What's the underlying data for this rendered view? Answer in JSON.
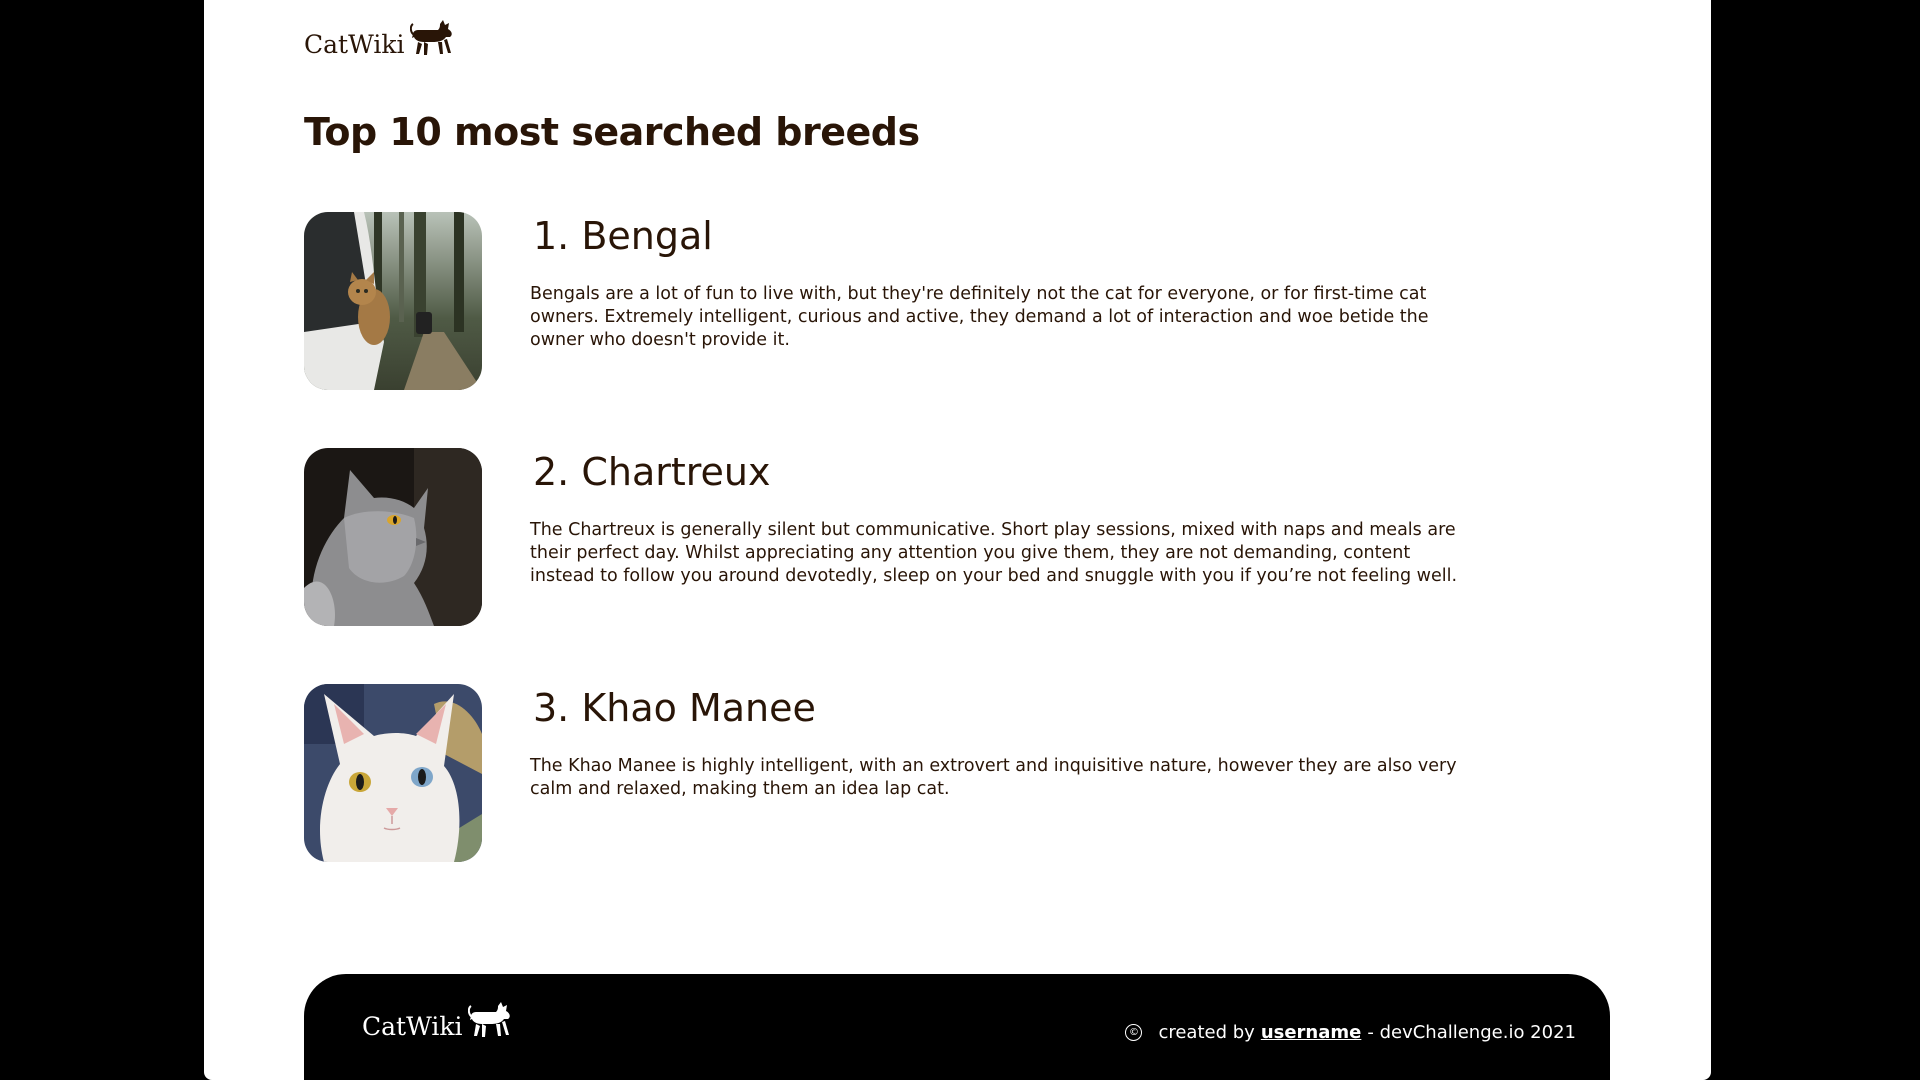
{
  "header": {
    "logo_text": "CatWiki"
  },
  "main": {
    "title": "Top 10 most searched breeds",
    "breeds": [
      {
        "name": "1. Bengal",
        "description": "Bengals are a lot of fun to live with, but they're definitely not the cat for everyone, or for first-time cat owners. Extremely intelligent, curious and active, they demand a lot of interaction and woe betide the owner who doesn't provide it."
      },
      {
        "name": "2. Chartreux",
        "description": "The Chartreux is generally silent but communicative. Short play sessions, mixed with naps and meals are their perfect day. Whilst appreciating any attention you give them, they are not demanding, content instead to follow you around devotedly, sleep on your bed and snuggle with you if you’re not feeling well."
      },
      {
        "name": "3. Khao Manee",
        "description": "The Khao Manee is highly intelligent, with an extrovert and inquisitive nature, however they are also very calm and relaxed, making them an idea lap cat."
      }
    ]
  },
  "footer": {
    "logo_text": "CatWiki",
    "copyright_symbol": "©",
    "created_by": "created by",
    "username": "username",
    "suffix": "- devChallenge.io 2021"
  },
  "colors": {
    "text": "#291507",
    "background": "#ffffff",
    "footer_bg": "#000000"
  }
}
